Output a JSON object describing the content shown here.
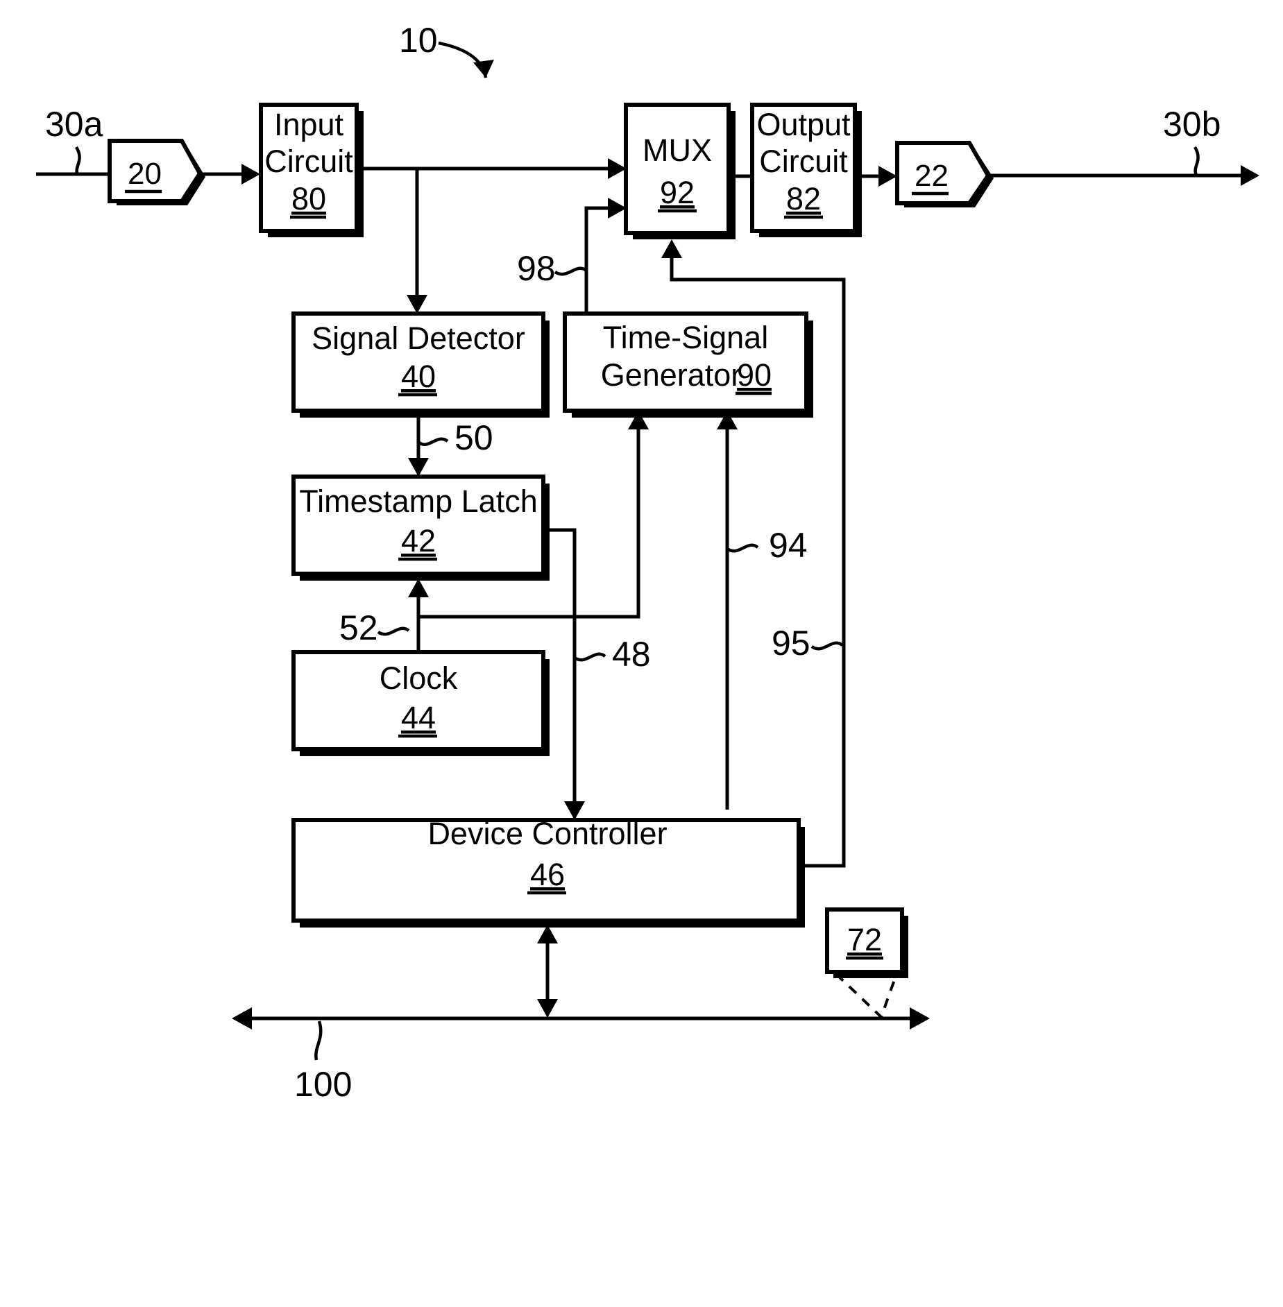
{
  "figure": {
    "number": "10"
  },
  "ports": {
    "left_label": "30a",
    "right_label": "30b",
    "left_connector_ref": "20",
    "right_connector_ref": "22"
  },
  "blocks": [
    {
      "id": "input-circuit",
      "line1": "Input",
      "line2": "Circuit",
      "ref": "80"
    },
    {
      "id": "mux",
      "line1": "MUX",
      "line2": "",
      "ref": "92"
    },
    {
      "id": "output-circuit",
      "line1": "Output",
      "line2": "Circuit",
      "ref": "82"
    },
    {
      "id": "signal-detector",
      "line1": "Signal Detector",
      "line2": "",
      "ref": "40"
    },
    {
      "id": "time-signal-generator",
      "line1": "Time-Signal",
      "line2": "Generator",
      "ref": "90"
    },
    {
      "id": "timestamp-latch",
      "line1": "Timestamp Latch",
      "line2": "",
      "ref": "42"
    },
    {
      "id": "clock",
      "line1": "Clock",
      "line2": "",
      "ref": "44"
    },
    {
      "id": "device-controller",
      "line1": "Device Controller",
      "line2": "",
      "ref": "46"
    }
  ],
  "signal_labels": {
    "detector_to_latch": "50",
    "clock_to_latch": "52",
    "latch_to_controller": "48",
    "generator_to_mux": "98",
    "controller_to_generator_94": "94",
    "controller_to_generator_95": "95"
  },
  "bus": {
    "ref": "100",
    "node_ref": "72"
  },
  "colors": {
    "line": "#000000",
    "fill": "#ffffff",
    "background": "#ffffff"
  }
}
